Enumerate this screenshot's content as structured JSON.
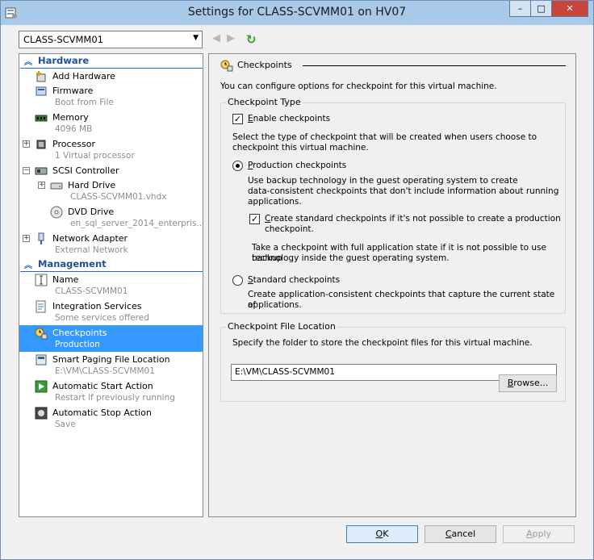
{
  "window": {
    "title": "Settings for CLASS-SCVMM01 on HV07",
    "minimize": "–",
    "maximize": "□",
    "close": "✕"
  },
  "toolbar": {
    "vm_selected": "CLASS-SCVMM01"
  },
  "tree": {
    "hardware_header": "Hardware",
    "management_header": "Management",
    "items": [
      {
        "label": "Add Hardware",
        "sub": ""
      },
      {
        "label": "Firmware",
        "sub": "Boot from File"
      },
      {
        "label": "Memory",
        "sub": "4096 MB"
      },
      {
        "label": "Processor",
        "sub": "1 Virtual processor"
      },
      {
        "label": "SCSI Controller",
        "sub": ""
      },
      {
        "label": "Hard Drive",
        "sub": "CLASS-SCVMM01.vhdx"
      },
      {
        "label": "DVD Drive",
        "sub": "en_sql_server_2014_enterpris..."
      },
      {
        "label": "Network Adapter",
        "sub": "External Network"
      },
      {
        "label": "Name",
        "sub": "CLASS-SCVMM01"
      },
      {
        "label": "Integration Services",
        "sub": "Some services offered"
      },
      {
        "label": "Checkpoints",
        "sub": "Production"
      },
      {
        "label": "Smart Paging File Location",
        "sub": "E:\\VM\\CLASS-SCVMM01"
      },
      {
        "label": "Automatic Start Action",
        "sub": "Restart if previously running"
      },
      {
        "label": "Automatic Stop Action",
        "sub": "Save"
      }
    ]
  },
  "content": {
    "header": "Checkpoints",
    "intro": "You can configure options for checkpoint for this virtual machine.",
    "type_group": {
      "title": "Checkpoint Type",
      "enable_label_u": "E",
      "enable_label_rest": "nable checkpoints",
      "enable_checked": true,
      "select_desc_1": "Select the type of checkpoint that will be created when users choose to",
      "select_desc_2": "checkpoint this virtual machine.",
      "production_label_u": "P",
      "production_label_rest": "roduction checkpoints",
      "production_selected": true,
      "production_desc_1": "Use backup technology in the guest operating system to create",
      "production_desc_2": "data-consistent checkpoints that don't include information about running",
      "production_desc_3": "applications.",
      "create_std_u": "C",
      "create_std_rest_1": "reate standard checkpoints if it's not possible to create a production",
      "create_std_rest_2": "checkpoint.",
      "create_std_checked": true,
      "full_state_1": "Take a checkpoint with full application state if it is not possible to use backup",
      "full_state_2": "technology inside the guest operating system.",
      "standard_label_u": "S",
      "standard_label_rest": "tandard checkpoints",
      "standard_selected": false,
      "standard_desc_1": "Create application-consistent checkpoints that capture the current state of",
      "standard_desc_2": "applications."
    },
    "location_group": {
      "title": "Checkpoint File Location",
      "desc": "Specify the folder to store the checkpoint files for this virtual machine.",
      "path": "E:\\VM\\CLASS-SCVMM01",
      "browse_u": "B",
      "browse_rest": "rowse..."
    }
  },
  "buttons": {
    "ok_u": "O",
    "ok_rest": "K",
    "cancel_u": "C",
    "cancel_rest": "ancel",
    "apply_u": "A",
    "apply_rest": "pply"
  },
  "colors": {
    "selection": "#3399ff",
    "section_header": "#1f4f95",
    "titlebar": "#a9c9e8",
    "close_button": "#c7453a"
  }
}
